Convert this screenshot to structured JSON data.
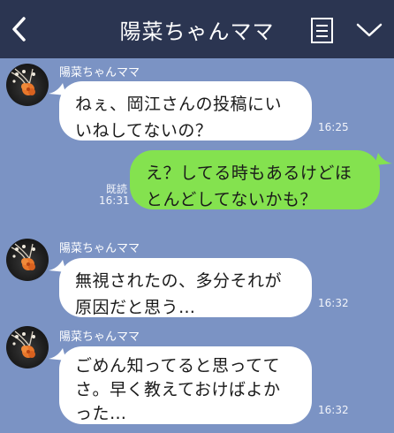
{
  "header": {
    "title": "陽菜ちゃんママ",
    "back_icon": "chevron-left-icon",
    "menu_icon": "notes-icon",
    "expand_icon": "chevron-down-icon",
    "background": "#2b3551"
  },
  "chat": {
    "background": "#7b93c4",
    "messages": [
      {
        "sender": "陽菜ちゃんママ",
        "lines": [
          "ねぇ、岡江さんの投稿にい",
          "いねしてないの？"
        ],
        "time": "16:25"
      },
      {
        "sender": "me",
        "lines": [
          "え？してる時もあるけどほ",
          "とんどしてないかも？"
        ],
        "read": "既読",
        "time": "16:31"
      },
      {
        "sender": "陽菜ちゃんママ",
        "lines": [
          "無視されたの、多分それが",
          "原因だと思う…"
        ],
        "time": "16:32"
      },
      {
        "sender": "陽菜ちゃんママ",
        "lines": [
          "ごめん知ってると思ってて",
          "さ。早く教えておけばよか",
          "った…"
        ],
        "time": "16:32"
      }
    ],
    "bubble_colors": {
      "incoming": "#ffffff",
      "outgoing": "#84e24f"
    }
  }
}
